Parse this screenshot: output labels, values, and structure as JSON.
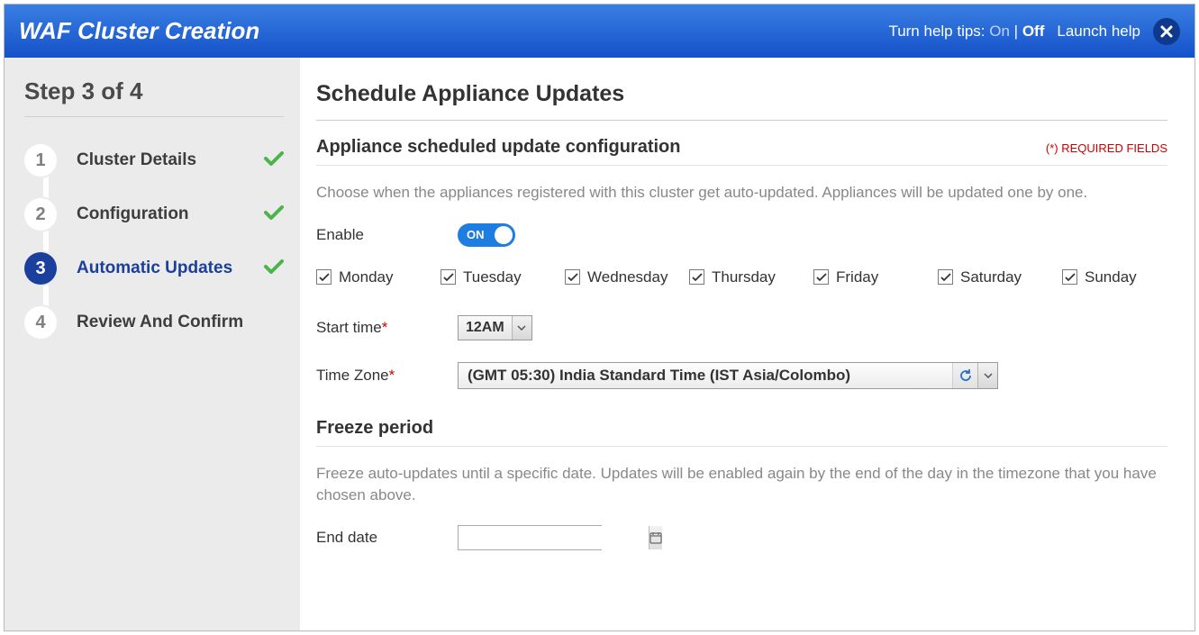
{
  "header": {
    "title": "WAF Cluster Creation",
    "help_prefix": "Turn help tips: ",
    "help_on": "On",
    "help_sep": " | ",
    "help_off": "Off",
    "launch_help": "Launch help"
  },
  "sidebar": {
    "heading": "Step 3 of 4",
    "steps": [
      {
        "num": "1",
        "label": "Cluster Details",
        "done": true,
        "current": false
      },
      {
        "num": "2",
        "label": "Configuration",
        "done": true,
        "current": false
      },
      {
        "num": "3",
        "label": "Automatic Updates",
        "done": true,
        "current": true
      },
      {
        "num": "4",
        "label": "Review And Confirm",
        "done": false,
        "current": false
      }
    ]
  },
  "main": {
    "title": "Schedule Appliance Updates",
    "section1": {
      "heading": "Appliance scheduled update configuration",
      "required_note": "(*) REQUIRED FIELDS",
      "description": "Choose when the appliances registered with this cluster get auto-updated. Appliances will be updated one by one.",
      "enable_label": "Enable",
      "toggle_text": "ON",
      "days": [
        "Monday",
        "Tuesday",
        "Wednesday",
        "Thursday",
        "Friday",
        "Saturday",
        "Sunday"
      ],
      "start_time_label": "Start time",
      "start_time_value": "12AM",
      "timezone_label": "Time Zone",
      "timezone_value": "(GMT 05:30) India Standard Time (IST Asia/Colombo)"
    },
    "section2": {
      "heading": "Freeze period",
      "description": "Freeze auto-updates until a specific date. Updates will be enabled again by the end of the day in the timezone that you have chosen above.",
      "end_date_label": "End date",
      "end_date_value": ""
    }
  }
}
